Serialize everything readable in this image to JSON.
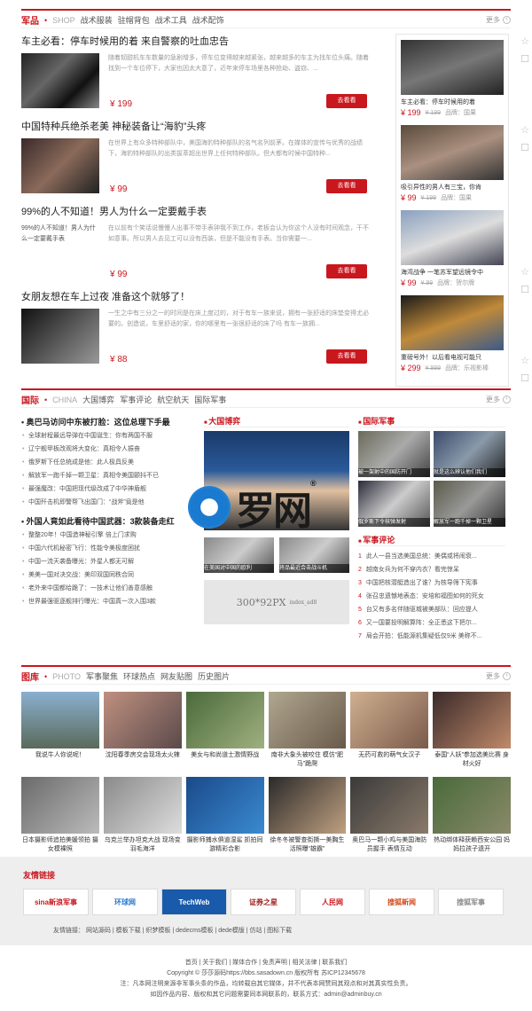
{
  "military": {
    "name": "军品",
    "dot": "•",
    "en": "SHOP",
    "tabs": [
      "战术服装",
      "驻帽背包",
      "战术工具",
      "战术配饰"
    ],
    "more": "更多"
  },
  "articles": [
    {
      "title": "车主必看：停车时候用的着 来自警察的吐血忠告",
      "desc": "随着韧甜机车车数量的急剧增多，停车位变得越来越紧张，越来越多的车主为找车位头痛。随着找到一个车位停下，大家也因太大意了，近年来停车场里各种抢劫、盗窃、...",
      "price": "¥ 199",
      "buy": "去看看"
    },
    {
      "title": "中国特种兵绝杀老美 神秘装备让“海豹”头疼",
      "desc": "在世界上有众多特种部队中，美国海豹特种部队的名气名列前茅。在媒体的宣传与优秀的战绩下，海豹特种部队的出类拔萃超出世界上任何特种部队。但大都有时候中国特种...",
      "price": "¥ 99",
      "buy": "去看看"
    },
    {
      "title": "99%的人不知道！男人为什么一定要戴手表",
      "desc": "在以前有个笑话说慢慢人出事不带手表钟我不到工作，老板会认为你这个人没有时间观念，干不如意事。所以男人去见工可以没有西装，但是不能没有手表。当你需要一...",
      "price": "¥ 99",
      "buy": "去看看",
      "alt": "99%的人不知道！男人为什么一定要戴手表"
    },
    {
      "title": "女朋友想在车上过夜 准备这个就够了！",
      "desc": "一生之中有三分之一的时间是在床上度过的，对于有车一族来说，拥有一张舒适的床垫变得尤必要的。创造说，车里舒适的家，你的哪里有一张很舒适的床了吗 有车一族拥...",
      "price": "¥ 88",
      "buy": "去看看"
    }
  ],
  "products": [
    {
      "name": "车主必看：停车时候用的着",
      "now": "¥ 199",
      "old": "¥ 199",
      "brand": "品牌：国果"
    },
    {
      "name": "吸引异性的男人有三宝，你肯",
      "now": "¥ 99",
      "old": "¥ 199",
      "brand": "品牌：国果"
    },
    {
      "name": "海湾战争 一笔苏军望远镜令中",
      "now": "¥ 99",
      "old": "¥ 99",
      "brand": "品牌：贺尔牌"
    },
    {
      "name": "重磅号外！以后看电视可能只",
      "now": "¥ 299",
      "old": "¥ 999",
      "brand": "品牌：乐视影棒"
    }
  ],
  "intl": {
    "name": "国际",
    "dot": "•",
    "en": "CHINA",
    "tabs": [
      "大国博弈",
      "军事评论",
      "航空航天",
      "国际军事"
    ],
    "more": "更多",
    "h1": "奥巴马访问中东被打脸：这位总理下手最",
    "list1": [
      "全球射程最远导弹在中国诞生：你有两国不服",
      "辽宁舰甲板改观将大变化：真相令人振奋",
      "俄罗斯下任总统成是他：此人极具反美",
      "解放军一跑千掉一颗卫星：真相令美国颤抖不已",
      "最强魔改：中国把现代级改成了中华神盾舰",
      "中国歼击机即警帮飞出国门：“战斧”竟是他"
    ],
    "h2": "外国人竟如此看待中国武器：3款装备走红",
    "list2": [
      "整整20年！中国造神秘引擎 倍上门求购",
      "中国六代机秘密飞行：性能令美极度困扰",
      "中国一流天袭备曝光：外星人都无可解",
      "美美一国对决交战：美印双国同秩合同",
      "老外来中国都给跪了：一技术让他们善意感触",
      "世界最强驱逐舰排行曝光：中国真一次入围3款"
    ],
    "sub_big": "大国博弈",
    "sub_mil": "国际军事",
    "sub_review": "军事评论",
    "captions": [
      "被一架射中的国防开门",
      "就是这么辨认他们我们",
      "俄罗斯下令核弹发射",
      "解放军一跑千掉一颗卫星"
    ],
    "small_caps": [
      "在美国对中国的欧利",
      "将品最近合击战斗机"
    ],
    "ad": "300*92PX",
    "ad_small": "index_ad8",
    "rank": [
      "此人一县当选美国总统：美偶或将闹衰...",
      "越南女兵为何不穿内衣？看完惊呆",
      "中国把核潜艇造出了谁？为核导筛下宪事",
      "张召忠遗憾地表态：安培和福图如何的死女",
      "台又有多名伴随驱城被美部队：回应提人",
      "又一国要投明解算阵：全正悉这下把尔...",
      "局会开拍：低能源机集疑低仅9米 美称不..."
    ]
  },
  "logo": {
    "text": "罗网",
    "reg": "®"
  },
  "gallery": {
    "name": "图库",
    "dot": "•",
    "en": "PHOTO",
    "tabs": [
      "军事聚焦",
      "环球热点",
      "网友贴图",
      "历史图片"
    ],
    "more": "更多",
    "items": [
      "我说牛人你说呢！",
      "沈阳春季房交会现场太火辣",
      "美女与和尚道士激情野战",
      "南非大象头被咬住  模仿“肥马”跪爬",
      "无药可救的萌气女汉子",
      "泰国“人妖”参加选美比赛 身材火好",
      "日本摄影师追拍美媛领拍 摄女模裸照",
      "乌克兰举办坦克大战 现场变羽毛海洋",
      "摄影师捕水俱道湿鲨 抓拍同游精彩合影",
      "徐冬冬被警查街撕一美胸生活照曝“雄霸”",
      "奥巴马一颗小鸡与美国海防员握手 表情互动",
      "热动绑体释获赖西安公园 妈妈拉孩子遗开"
    ]
  },
  "friends": {
    "title": "友情链接",
    "logos": [
      "sina新浪军事",
      "环球网",
      "TechWeb",
      "证券之星",
      "人民网",
      "搜狐新闻",
      "搜狐军事"
    ],
    "label": "友情链接：",
    "links": "网站源码 | 模板下载 | 织梦模板 | dedecms模板 | dede模版 | 仿站 | 图标下载"
  },
  "footer": {
    "nav": "首页 | 关于我们 | 媒体合作 | 免责声明 | 相关法律 | 联系我们",
    "copy": "Copyright © 莎莎源码https://bbs.sasadown.cn 版权所有 苏ICP12345678",
    "note": "注：凡本网注明来源非军事头条的作品，均转载自其它媒体，并不代表本网赞同其观点和对其真实性负责。",
    "contact": "如因作品内容、版权和其它问题需要同本网联系的，联系方式：admin@adminbuy.cn"
  },
  "rail": [
    "☆",
    "☐",
    "☆",
    "☐",
    "☆",
    "☐",
    "☆",
    "☐"
  ]
}
